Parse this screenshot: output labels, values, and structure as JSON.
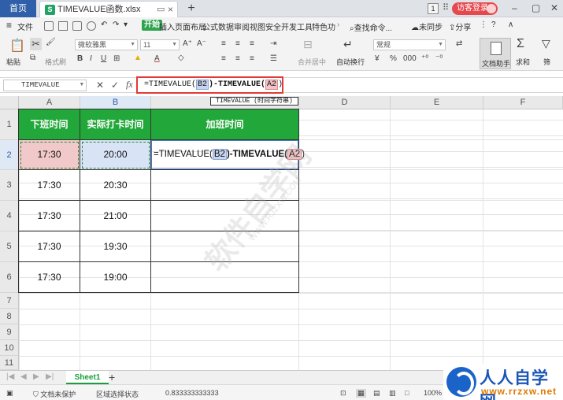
{
  "titlebar": {
    "home_tab": "首页",
    "file_tab": "TIMEVALUE函数.xlsx",
    "xl_icon": "S",
    "badge": "1",
    "login": "访客登录"
  },
  "menubar": {
    "file": "文件",
    "items": [
      "开始",
      "插入",
      "页面布局",
      "公式",
      "数据",
      "审阅",
      "视图",
      "安全",
      "开发工具",
      "特色功"
    ],
    "search": "查找命令...",
    "sync": "未同步",
    "share": "分享"
  },
  "ribbon": {
    "paste": "粘贴",
    "format_painter": "格式刷",
    "font": "微软雅黑",
    "size": "11",
    "merge": "合并居中",
    "wrap": "自动换行",
    "number_format": "常规",
    "assistant": "文档助手",
    "sum": "求和",
    "filter": "筛"
  },
  "formulabar": {
    "namebox": "TIMEVALUE",
    "fx": "fx",
    "formula_prefix": "=TIMEVALUE(",
    "ref1": "B2",
    "mid": ")-TIMEVALUE(",
    "ref2": "A2",
    "suffix": ")"
  },
  "tooltip": "TIMEVALUE (时间字符串)",
  "columns": [
    "A",
    "B",
    "C",
    "D",
    "E",
    "F"
  ],
  "rows": [
    "1",
    "2",
    "3",
    "4",
    "5",
    "6",
    "7",
    "8",
    "9",
    "10",
    "11"
  ],
  "table": {
    "headers": [
      "下班时间",
      "实际打卡时间",
      "加班时间"
    ],
    "data": [
      [
        "17:30",
        "20:00"
      ],
      [
        "17:30",
        "20:30"
      ],
      [
        "17:30",
        "21:00"
      ],
      [
        "17:30",
        "19:30"
      ],
      [
        "17:30",
        "19:00"
      ]
    ],
    "editing_cell": {
      "prefix": "=TIMEVALUE(",
      "ref1": "B2",
      "mid": ")-TIMEVALUE(",
      "ref2": "A2",
      "suffix": ")"
    }
  },
  "watermark": {
    "main": "软件自学网",
    "sub": "WWW.RJZXW.COM"
  },
  "sheetbar": {
    "sheet": "Sheet1",
    "add": "+"
  },
  "statusbar": {
    "protect": "文档未保护",
    "mode": "区域选择状态",
    "value": "0.833333333333",
    "zoom": "100%"
  },
  "logo": {
    "title": "人人自学网",
    "url": "www.rrzxw.net"
  },
  "colors": {
    "header_green": "#22a83a",
    "ref1": "#c7d5ef",
    "ref2": "#f3c4c6",
    "highlight": "#e53935"
  }
}
